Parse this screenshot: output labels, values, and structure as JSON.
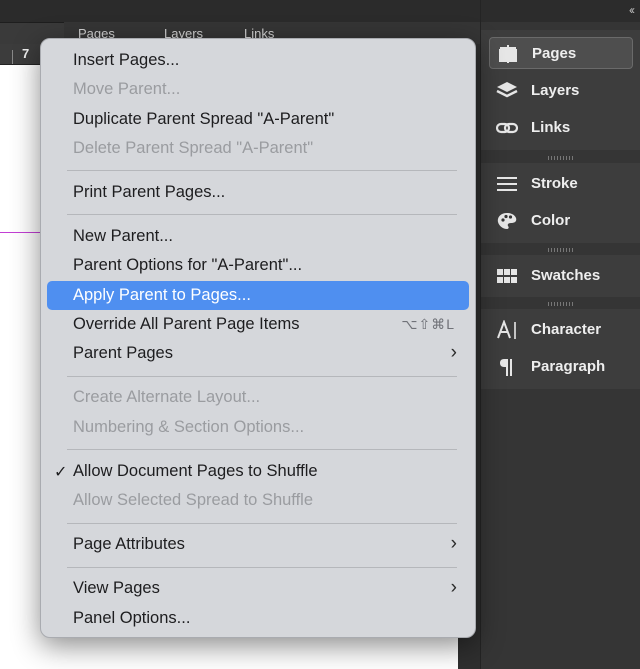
{
  "ruler": {
    "number": "7"
  },
  "background_tabs": [
    "Pages",
    "Layers",
    "Links"
  ],
  "dock": {
    "collapse_icon": "double-chevron-left-icon",
    "items": [
      {
        "label": "Pages",
        "icon": "pages-icon",
        "active": true
      },
      {
        "label": "Layers",
        "icon": "layers-icon"
      },
      {
        "label": "Links",
        "icon": "links-icon"
      },
      {
        "label": "Stroke",
        "icon": "stroke-icon"
      },
      {
        "label": "Color",
        "icon": "color-palette-icon"
      },
      {
        "label": "Swatches",
        "icon": "swatches-icon"
      },
      {
        "label": "Character",
        "icon": "character-icon"
      },
      {
        "label": "Paragraph",
        "icon": "paragraph-icon"
      }
    ]
  },
  "menu": {
    "items": [
      {
        "label": "Insert Pages...",
        "enabled": true
      },
      {
        "label": "Move Parent...",
        "enabled": false
      },
      {
        "label": "Duplicate Parent Spread \"A-Parent\"",
        "enabled": true
      },
      {
        "label": "Delete Parent Spread \"A-Parent\"",
        "enabled": false
      },
      {
        "label": "Print Parent Pages...",
        "enabled": true
      },
      {
        "label": "New Parent...",
        "enabled": true
      },
      {
        "label": "Parent Options for \"A-Parent\"...",
        "enabled": true
      },
      {
        "label": "Apply Parent to Pages...",
        "enabled": true,
        "highlighted": true
      },
      {
        "label": "Override All Parent Page Items",
        "enabled": true,
        "shortcut": "⌥⇧⌘L"
      },
      {
        "label": "Parent Pages",
        "enabled": true,
        "submenu": true
      },
      {
        "label": "Create Alternate Layout...",
        "enabled": false
      },
      {
        "label": "Numbering & Section Options...",
        "enabled": false
      },
      {
        "label": "Allow Document Pages to Shuffle",
        "enabled": true,
        "checked": true,
        "check_mark": "✓"
      },
      {
        "label": "Allow Selected Spread to Shuffle",
        "enabled": false
      },
      {
        "label": "Page Attributes",
        "enabled": true,
        "submenu": true
      },
      {
        "label": "View Pages",
        "enabled": true,
        "submenu": true
      },
      {
        "label": "Panel Options...",
        "enabled": true
      }
    ],
    "submenu_glyph": "›"
  },
  "colors": {
    "highlight": "#4f8ff0",
    "menu_bg": "#d5d7db",
    "dock_bg": "#353535",
    "guide": "#c23fd4"
  }
}
